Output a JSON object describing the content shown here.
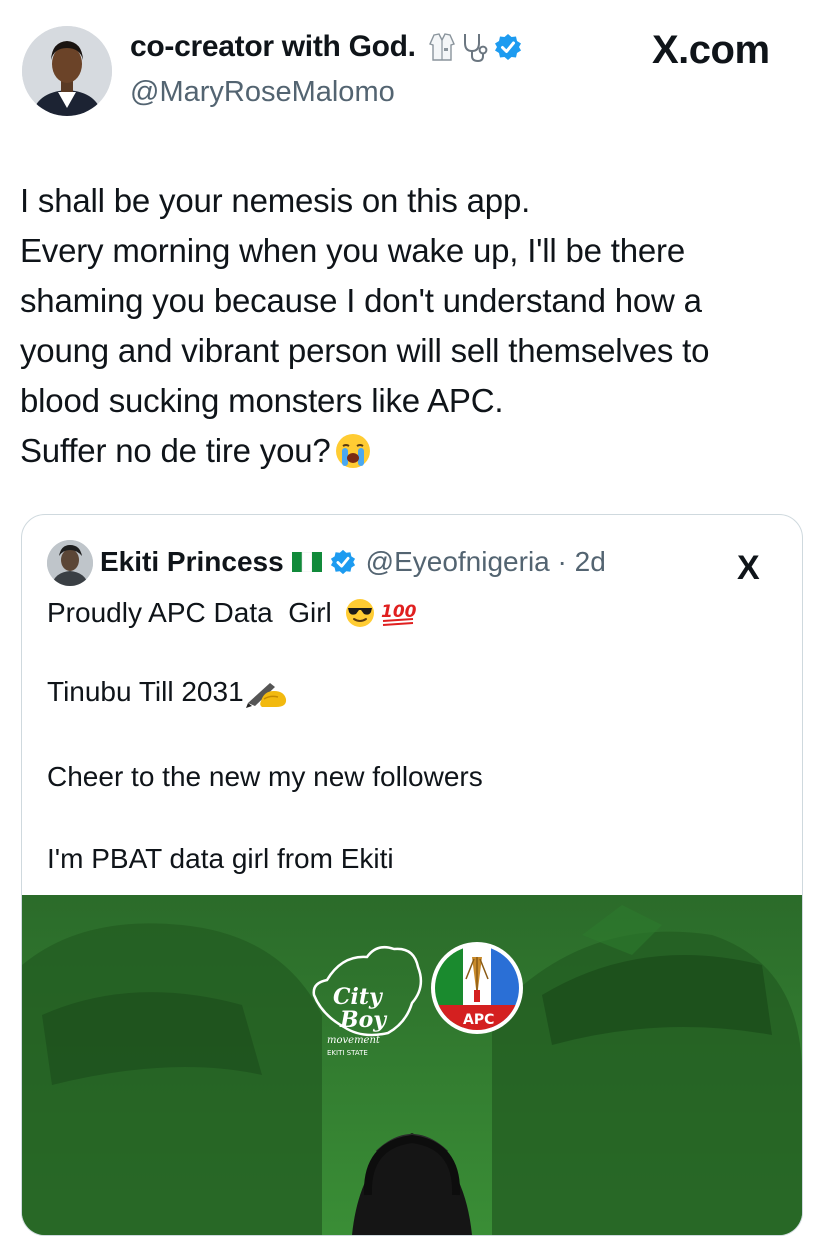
{
  "author": {
    "display_name": "co-creator with God.",
    "handle": "@MaryRoseMalomo",
    "emoji_icons": [
      "lab-coat-icon",
      "stethoscope-icon"
    ],
    "verified": true
  },
  "source_label": "X.com",
  "tweet_lines": [
    "I shall be your nemesis on this app.",
    "Every morning when you wake up, I'll be there",
    "shaming you because I don't understand how a",
    "young and vibrant person will sell themselves to",
    "blood sucking monsters like APC.",
    "Suffer no de tire you?"
  ],
  "tweet_end_emoji": "crying-face-icon",
  "quoted_tweet": {
    "display_name": "Ekiti Princess",
    "flag_icon": "nigeria-flag-icon",
    "verified": true,
    "handle_time": "@Eyeofnigeria · 2d",
    "x_label": "X",
    "line1": "Proudly APC Data  Girl",
    "line1_emojis": [
      "sunglasses-face-icon",
      "hundred-points-icon"
    ],
    "line2": "Tinubu Till 2031",
    "line2_emoji": "writing-hand-icon",
    "line3": "Cheer to the new my new followers",
    "line4": "I'm PBAT data girl from Ekiti"
  },
  "media": {
    "logo_city": "City",
    "logo_boy": "Boy",
    "logo_movement": "movement",
    "logo_state": "EKITI STATE",
    "party_label": "APC",
    "colors": {
      "background": "#2f7a2c",
      "apc_green": "#1a8a2e",
      "apc_blue": "#2a6fd6",
      "apc_red": "#d42020"
    }
  },
  "colors": {
    "verified_blue": "#1d9bf0",
    "secondary_text": "#536471",
    "border": "#cfd9de"
  }
}
